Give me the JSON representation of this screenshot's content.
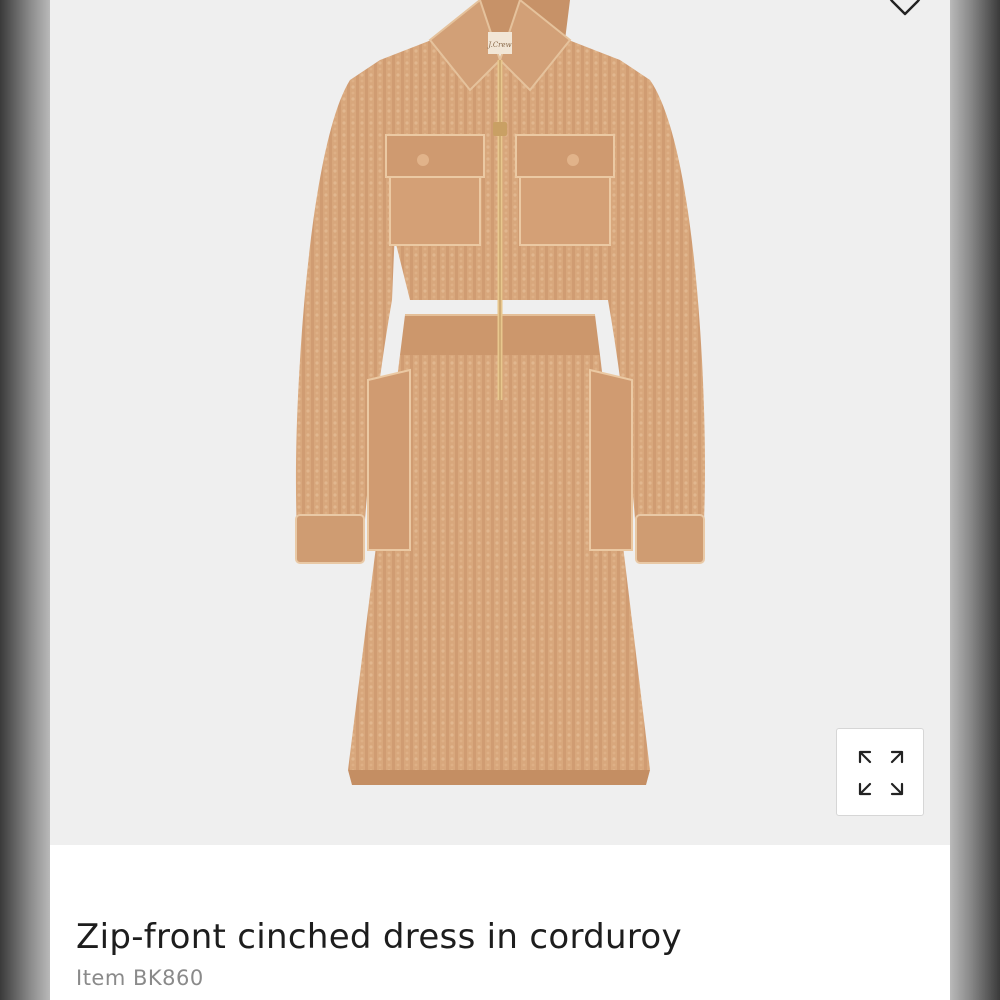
{
  "product": {
    "title": "Zip-front cinched dress in corduroy",
    "item_number": "Item BK860",
    "color_swatch": "#d8a77c"
  },
  "image": {
    "background": "#efefef",
    "brand_tag": "J.Crew"
  },
  "icons": {
    "wishlist": "heart-icon",
    "expand": "expand-arrows-icon"
  }
}
